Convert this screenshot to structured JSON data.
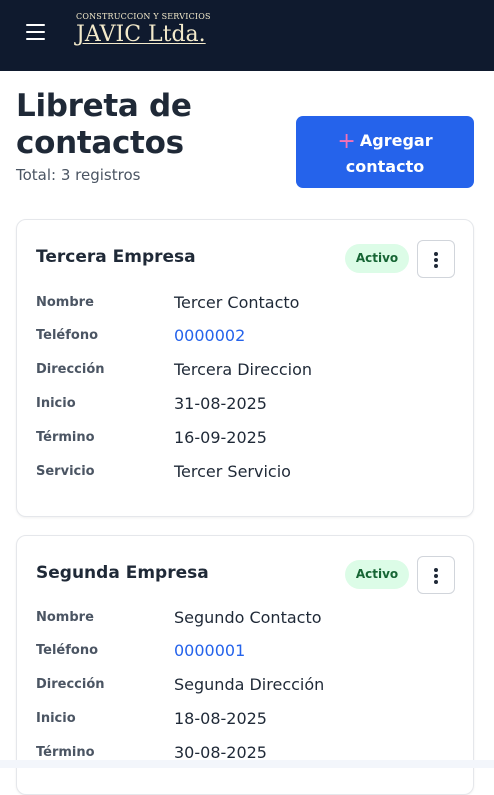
{
  "navbar": {
    "logo_top": "CONSTRUCCION Y SERVICIOS",
    "logo_main": "JAVIC Ltda.",
    "menu_icon": "hamburger-icon"
  },
  "header": {
    "title": "Libreta de contactos",
    "subtitle": "Total: 3 registros",
    "add_button_label": "Agregar contacto",
    "add_icon": "plus-icon",
    "accent_color": "#2563eb"
  },
  "labels": {
    "nombre": "Nombre",
    "telefono": "Teléfono",
    "direccion": "Dirección",
    "inicio": "Inicio",
    "termino": "Término",
    "servicio": "Servicio"
  },
  "contacts": [
    {
      "empresa": "Tercera Empresa",
      "status": "Activo",
      "nombre": "Tercer Contacto",
      "telefono": "0000002",
      "direccion": "Tercera Direccion",
      "inicio": "31-08-2025",
      "termino": "16-09-2025",
      "servicio": "Tercer Servicio"
    },
    {
      "empresa": "Segunda Empresa",
      "status": "Activo",
      "nombre": "Segundo Contacto",
      "telefono": "0000001",
      "direccion": "Segunda Dirección",
      "inicio": "18-08-2025",
      "termino": "30-08-2025"
    }
  ]
}
